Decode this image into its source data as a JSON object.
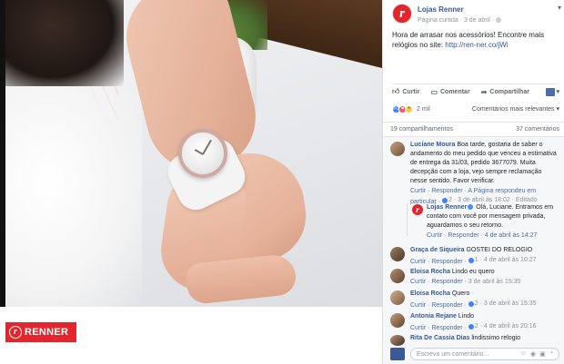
{
  "photo": {
    "logo_letter": "r",
    "logo_text": "RENNER"
  },
  "post": {
    "page_avatar_letter": "r",
    "page_name": "Lojas Renner",
    "meta": "Página curtida · 3 de abril · ",
    "text": "Hora de arrasar nos acessórios! Encontre mais relógios no site: ",
    "link": "http://ren-ner.co/jWi",
    "actions": {
      "like": "Curtir",
      "comment": "Comentar",
      "share": "Compartilhar"
    },
    "reactions_count": "2 mil",
    "relevance": "Comentários mais relevantes ▾",
    "shares": "19 compartilhamentos",
    "comments_count": "37 comentários"
  },
  "comments": [
    {
      "author": "Luciane Moura",
      "text": " Boa tarde, gostaria de saber o andamento do meu pedido que venceu a estimativa de entrega da 31/03, pedido 3677079. Muita decepção com a loja, vejo sempre reclamação nesse sentido. Favor verificar.",
      "meta": "Curtir · Responder · A Página respondeu em particular · ",
      "meta2": "2 · 3 de abril às 18:02 · Editado"
    },
    {
      "author": "Graça de Siqueira",
      "text": " GOSTEI DO RELOGIO",
      "meta": "Curtir · Responder · ",
      "meta2": "1 · 4 de abril às 10:27"
    },
    {
      "author": "Eloisa Rocha",
      "text": " Lindo eu quero",
      "meta": "Curtir · Responder · ",
      "meta2": "3 de abril às 15:35"
    },
    {
      "author": "Eloisa Rocha",
      "text": " Quero",
      "meta": "Curtir · Responder · ",
      "meta2": "2 · 3 de abril às 15:35"
    },
    {
      "author": "Antonia Rejane",
      "text": " Lindo",
      "meta": "Curtir · Responder · ",
      "meta2": "2 · 4 de abril às 20:16"
    },
    {
      "author": "Rita De Cassia Dias",
      "text": " lindissimo relogio"
    }
  ],
  "reply": {
    "avatar_letter": "r",
    "author": "Lojas Renner",
    "text": " Olá, Luciane. Entramos em contato com você por mensagem privada, aguardamos o seu retorno.",
    "meta": "Curtir · Responder · 4 de abril às 14:27"
  },
  "write_comment": {
    "placeholder": "Escreva um comentário..."
  }
}
